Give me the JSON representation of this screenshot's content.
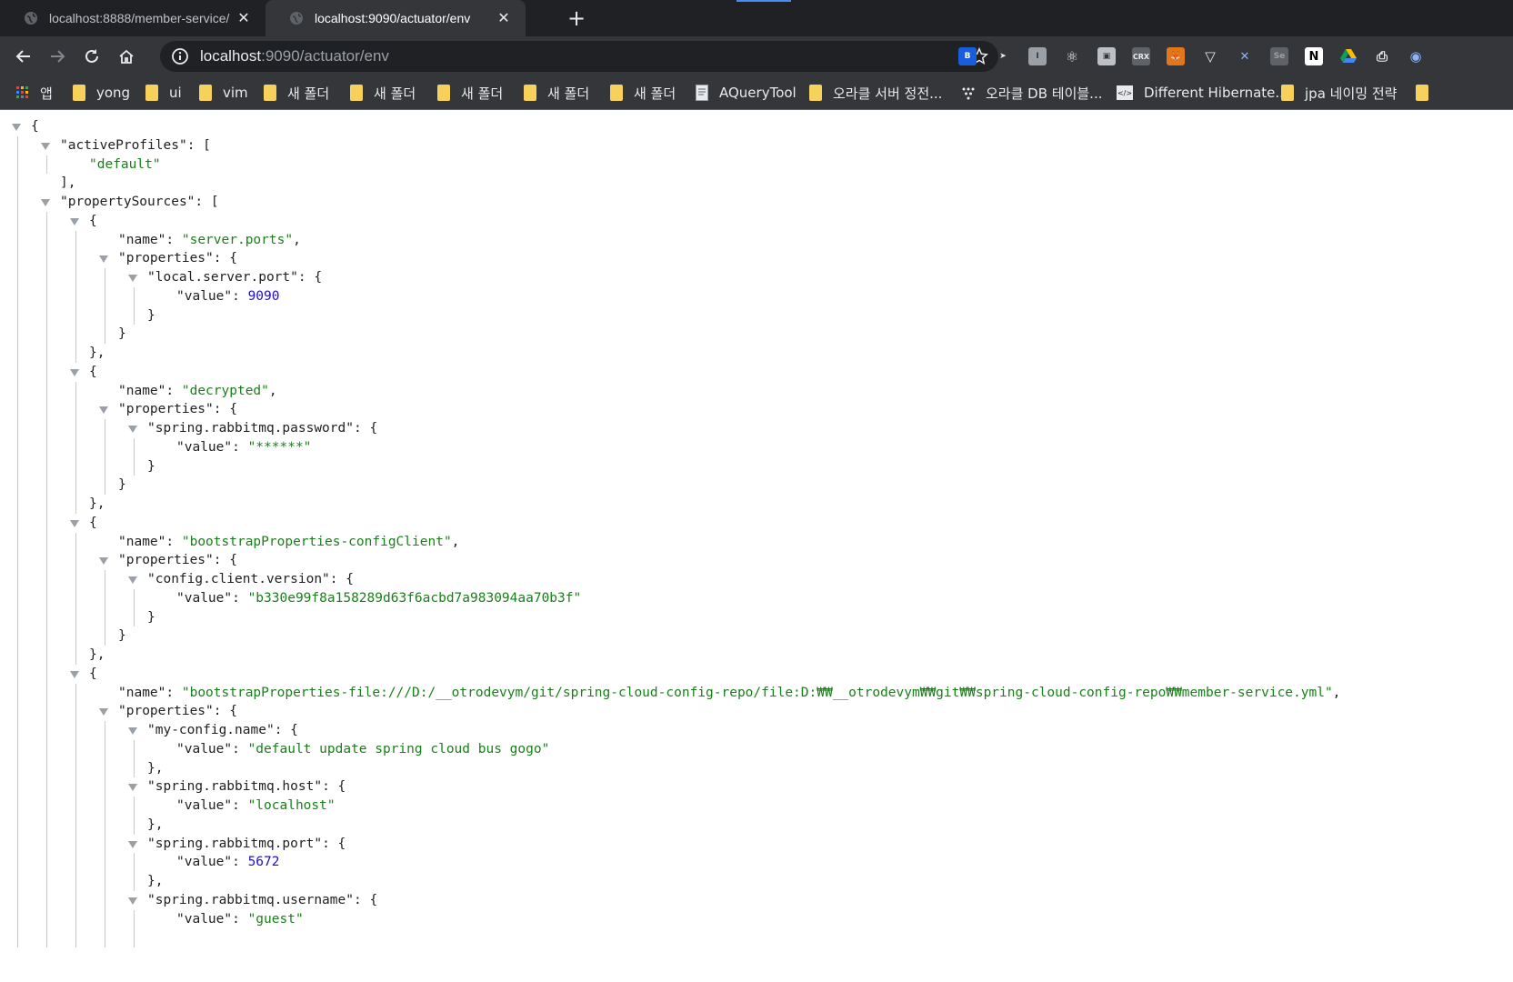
{
  "tabs": [
    {
      "title": "localhost:8888/member-service/",
      "active": false
    },
    {
      "title": "localhost:9090/actuator/env",
      "active": true
    }
  ],
  "address": {
    "host": "localhost",
    "rest": ":9090/actuator/env"
  },
  "extensions": [
    "bitwarden-icon",
    "cursor-icon",
    "ext-i-icon",
    "react-devtools-icon",
    "ext-box-icon",
    "crx-icon",
    "metamask-icon",
    "vuetify-icon",
    "x-icon",
    "selenium-icon",
    "notion-icon",
    "google-drive-icon",
    "printer-icon",
    "globe-icon"
  ],
  "bookmarks": [
    {
      "label": "앱",
      "icon": "apps-grid-icon"
    },
    {
      "label": "yong",
      "icon": "folder-icon"
    },
    {
      "label": "ui",
      "icon": "folder-icon"
    },
    {
      "label": "vim",
      "icon": "folder-icon"
    },
    {
      "label": "새 폴더",
      "icon": "folder-icon"
    },
    {
      "label": "새 폴더",
      "icon": "folder-icon"
    },
    {
      "label": "새 폴더",
      "icon": "folder-icon"
    },
    {
      "label": "새 폴더",
      "icon": "folder-icon"
    },
    {
      "label": "새 폴더",
      "icon": "folder-icon"
    },
    {
      "label": "AQueryTool",
      "icon": "page-icon"
    },
    {
      "label": "오라클 서버 정전...",
      "icon": "folder-icon"
    },
    {
      "label": "오라클 DB 테이블...",
      "icon": "dots-icon"
    },
    {
      "label": "Different Hibernate...",
      "icon": "code-icon"
    },
    {
      "label": "jpa 네이밍 전략",
      "icon": "folder-icon"
    }
  ],
  "json_lines": [
    {
      "indent": 0,
      "tri": true,
      "parts": [
        [
          "p",
          "{"
        ]
      ]
    },
    {
      "indent": 1,
      "tri": true,
      "parts": [
        [
          "k",
          "\"activeProfiles\""
        ],
        [
          "p",
          ": ["
        ]
      ]
    },
    {
      "indent": 2,
      "tri": false,
      "parts": [
        [
          "s",
          "\"default\""
        ]
      ]
    },
    {
      "indent": 1,
      "tri": false,
      "parts": [
        [
          "p",
          "],"
        ]
      ]
    },
    {
      "indent": 1,
      "tri": true,
      "parts": [
        [
          "k",
          "\"propertySources\""
        ],
        [
          "p",
          ": ["
        ]
      ]
    },
    {
      "indent": 2,
      "tri": true,
      "parts": [
        [
          "p",
          "{"
        ]
      ]
    },
    {
      "indent": 3,
      "tri": false,
      "parts": [
        [
          "k",
          "\"name\""
        ],
        [
          "p",
          ": "
        ],
        [
          "s",
          "\"server.ports\""
        ],
        [
          "p",
          ","
        ]
      ]
    },
    {
      "indent": 3,
      "tri": true,
      "parts": [
        [
          "k",
          "\"properties\""
        ],
        [
          "p",
          ": {"
        ]
      ]
    },
    {
      "indent": 4,
      "tri": true,
      "parts": [
        [
          "k",
          "\"local.server.port\""
        ],
        [
          "p",
          ": {"
        ]
      ]
    },
    {
      "indent": 5,
      "tri": false,
      "parts": [
        [
          "k",
          "\"value\""
        ],
        [
          "p",
          ": "
        ],
        [
          "n",
          "9090"
        ]
      ]
    },
    {
      "indent": 4,
      "tri": false,
      "parts": [
        [
          "p",
          "}"
        ]
      ]
    },
    {
      "indent": 3,
      "tri": false,
      "parts": [
        [
          "p",
          "}"
        ]
      ]
    },
    {
      "indent": 2,
      "tri": false,
      "parts": [
        [
          "p",
          "},"
        ]
      ]
    },
    {
      "indent": 2,
      "tri": true,
      "parts": [
        [
          "p",
          "{"
        ]
      ]
    },
    {
      "indent": 3,
      "tri": false,
      "parts": [
        [
          "k",
          "\"name\""
        ],
        [
          "p",
          ": "
        ],
        [
          "s",
          "\"decrypted\""
        ],
        [
          "p",
          ","
        ]
      ]
    },
    {
      "indent": 3,
      "tri": true,
      "parts": [
        [
          "k",
          "\"properties\""
        ],
        [
          "p",
          ": {"
        ]
      ]
    },
    {
      "indent": 4,
      "tri": true,
      "parts": [
        [
          "k",
          "\"spring.rabbitmq.password\""
        ],
        [
          "p",
          ": {"
        ]
      ]
    },
    {
      "indent": 5,
      "tri": false,
      "parts": [
        [
          "k",
          "\"value\""
        ],
        [
          "p",
          ": "
        ],
        [
          "s",
          "\"******\""
        ]
      ]
    },
    {
      "indent": 4,
      "tri": false,
      "parts": [
        [
          "p",
          "}"
        ]
      ]
    },
    {
      "indent": 3,
      "tri": false,
      "parts": [
        [
          "p",
          "}"
        ]
      ]
    },
    {
      "indent": 2,
      "tri": false,
      "parts": [
        [
          "p",
          "},"
        ]
      ]
    },
    {
      "indent": 2,
      "tri": true,
      "parts": [
        [
          "p",
          "{"
        ]
      ]
    },
    {
      "indent": 3,
      "tri": false,
      "parts": [
        [
          "k",
          "\"name\""
        ],
        [
          "p",
          ": "
        ],
        [
          "s",
          "\"bootstrapProperties-configClient\""
        ],
        [
          "p",
          ","
        ]
      ]
    },
    {
      "indent": 3,
      "tri": true,
      "parts": [
        [
          "k",
          "\"properties\""
        ],
        [
          "p",
          ": {"
        ]
      ]
    },
    {
      "indent": 4,
      "tri": true,
      "parts": [
        [
          "k",
          "\"config.client.version\""
        ],
        [
          "p",
          ": {"
        ]
      ]
    },
    {
      "indent": 5,
      "tri": false,
      "parts": [
        [
          "k",
          "\"value\""
        ],
        [
          "p",
          ": "
        ],
        [
          "s",
          "\"b330e99f8a158289d63f6acbd7a983094aa70b3f\""
        ]
      ]
    },
    {
      "indent": 4,
      "tri": false,
      "parts": [
        [
          "p",
          "}"
        ]
      ]
    },
    {
      "indent": 3,
      "tri": false,
      "parts": [
        [
          "p",
          "}"
        ]
      ]
    },
    {
      "indent": 2,
      "tri": false,
      "parts": [
        [
          "p",
          "},"
        ]
      ]
    },
    {
      "indent": 2,
      "tri": true,
      "parts": [
        [
          "p",
          "{"
        ]
      ]
    },
    {
      "indent": 3,
      "tri": false,
      "parts": [
        [
          "k",
          "\"name\""
        ],
        [
          "p",
          ": "
        ],
        [
          "s",
          "\"bootstrapProperties-file:///D:/__otrodevym/git/spring-cloud-config-repo/file:D:₩₩__otrodevym₩₩git₩₩spring-cloud-config-repo₩₩member-service.yml\""
        ],
        [
          "p",
          ","
        ]
      ]
    },
    {
      "indent": 3,
      "tri": true,
      "parts": [
        [
          "k",
          "\"properties\""
        ],
        [
          "p",
          ": {"
        ]
      ]
    },
    {
      "indent": 4,
      "tri": true,
      "parts": [
        [
          "k",
          "\"my-config.name\""
        ],
        [
          "p",
          ": {"
        ]
      ]
    },
    {
      "indent": 5,
      "tri": false,
      "parts": [
        [
          "k",
          "\"value\""
        ],
        [
          "p",
          ": "
        ],
        [
          "s",
          "\"default update spring cloud bus gogo\""
        ]
      ]
    },
    {
      "indent": 4,
      "tri": false,
      "parts": [
        [
          "p",
          "},"
        ]
      ]
    },
    {
      "indent": 4,
      "tri": true,
      "parts": [
        [
          "k",
          "\"spring.rabbitmq.host\""
        ],
        [
          "p",
          ": {"
        ]
      ]
    },
    {
      "indent": 5,
      "tri": false,
      "parts": [
        [
          "k",
          "\"value\""
        ],
        [
          "p",
          ": "
        ],
        [
          "s",
          "\"localhost\""
        ]
      ]
    },
    {
      "indent": 4,
      "tri": false,
      "parts": [
        [
          "p",
          "},"
        ]
      ]
    },
    {
      "indent": 4,
      "tri": true,
      "parts": [
        [
          "k",
          "\"spring.rabbitmq.port\""
        ],
        [
          "p",
          ": {"
        ]
      ]
    },
    {
      "indent": 5,
      "tri": false,
      "parts": [
        [
          "k",
          "\"value\""
        ],
        [
          "p",
          ": "
        ],
        [
          "n",
          "5672"
        ]
      ]
    },
    {
      "indent": 4,
      "tri": false,
      "parts": [
        [
          "p",
          "},"
        ]
      ]
    },
    {
      "indent": 4,
      "tri": true,
      "parts": [
        [
          "k",
          "\"spring.rabbitmq.username\""
        ],
        [
          "p",
          ": {"
        ]
      ]
    },
    {
      "indent": 5,
      "tri": false,
      "parts": [
        [
          "k",
          "\"value\""
        ],
        [
          "p",
          ": "
        ],
        [
          "s",
          "\"guest\""
        ]
      ]
    }
  ]
}
